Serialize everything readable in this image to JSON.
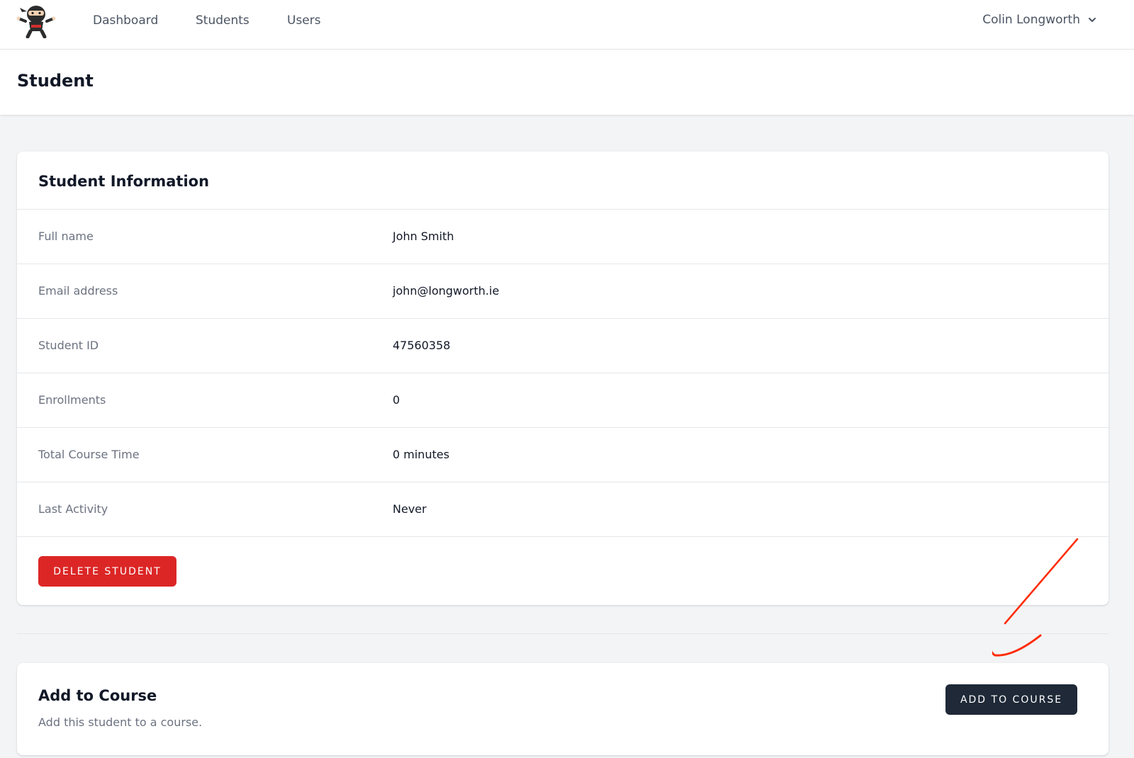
{
  "nav": {
    "links": [
      "Dashboard",
      "Students",
      "Users"
    ],
    "user_name": "Colin Longworth"
  },
  "header": {
    "title": "Student"
  },
  "student_info": {
    "title": "Student Information",
    "rows": [
      {
        "label": "Full name",
        "value": "John Smith"
      },
      {
        "label": "Email address",
        "value": "john@longworth.ie"
      },
      {
        "label": "Student ID",
        "value": "47560358"
      },
      {
        "label": "Enrollments",
        "value": "0"
      },
      {
        "label": "Total Course Time",
        "value": "0 minutes"
      },
      {
        "label": "Last Activity",
        "value": "Never"
      }
    ],
    "delete_label": "DELETE STUDENT"
  },
  "add_course": {
    "title": "Add to Course",
    "description": "Add this student to a course.",
    "button_label": "ADD TO COURSE"
  },
  "colors": {
    "danger": "#dc2626",
    "primary_dark": "#1f2937",
    "annotation": "#ff2a00"
  }
}
